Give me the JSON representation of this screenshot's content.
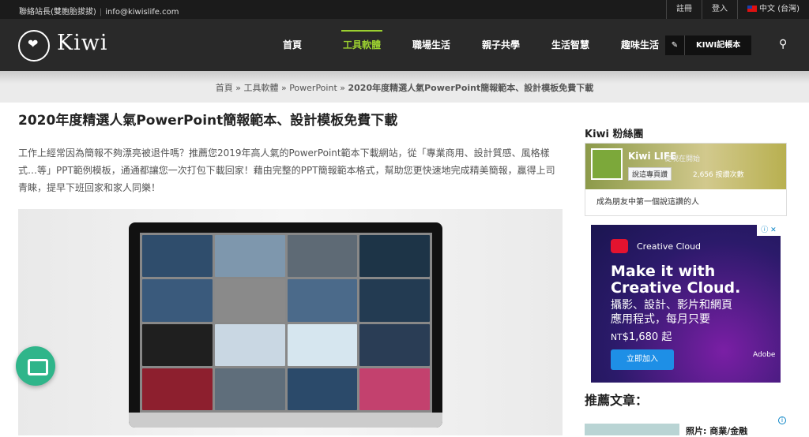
{
  "topbar": {
    "contact": "聯絡站長(雙胞胎拔拔)",
    "separator": "|",
    "email": "info@kiwislife.com",
    "register": "註冊",
    "login": "登入",
    "language": "中文 (台灣)"
  },
  "header": {
    "logo_text": "Kiwi",
    "nav": [
      "首頁",
      "工具軟體",
      "職場生活",
      "親子共學",
      "生活智慧",
      "趣味生活"
    ],
    "active_nav": "工具軟體",
    "notebook_label": "KIWI記帳本"
  },
  "breadcrumb": {
    "home": "首頁",
    "sep": "»",
    "category": "工具軟體",
    "sub": "PowerPoint",
    "current": "2020年度精選人氣PowerPoint簡報範本、設計模板免費下載"
  },
  "article": {
    "title": "2020年度精選人氣PowerPoint簡報範本、設計模板免費下載",
    "intro": "工作上經常因為簡報不夠漂亮被退件嗎？推薦您2019年高人氣的PowerPoint範本下載網站，從「專業商用、設計質感、風格樣式…等」PPT範例模板，通通都讓您一次打包下載回家！藉由完整的PPT簡報範本格式，幫助您更快速地完成精美簡報，贏得上司青睞，提早下班回家和家人同樂！"
  },
  "sidebar": {
    "fans_heading": "Kiwi 粉絲團",
    "fb": {
      "page_name": "Kiwi LIFE",
      "subtitle": "從現在開始",
      "share_button": "說這專頁讚",
      "likes": "2,656 按讚次數",
      "footer": "成為朋友中第一個說這讚的人"
    },
    "ad": {
      "brand": "Creative Cloud",
      "headline_1": "Make it with",
      "headline_2": "Creative Cloud.",
      "text_1": "攝影、設計、影片和網頁",
      "text_2": "應用程式，每月只要",
      "price_prefix": "NT",
      "price": "$1,680 起",
      "cta": "立即加入",
      "adobe": "Adobe"
    },
    "recommend_heading": "推薦文章：",
    "recommend_item": "照片: 商業/金融"
  },
  "colors": {
    "accent": "#9bd030",
    "chat": "#2fb58a",
    "ad_button": "#1e8fe6"
  }
}
